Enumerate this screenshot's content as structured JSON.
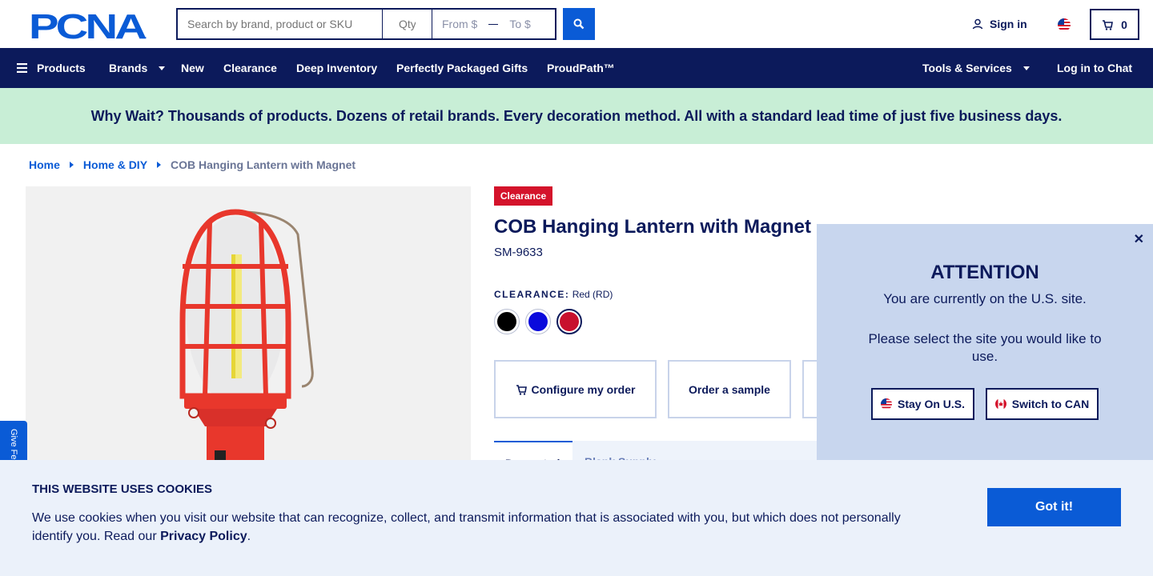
{
  "header": {
    "logo_text": "PCNA",
    "search_placeholder": "Search by brand, product or SKU",
    "qty_placeholder": "Qty",
    "price_from": "From $",
    "price_to": "To $",
    "signin_label": "Sign in",
    "cart_count": "0"
  },
  "nav": {
    "products": "Products",
    "brands": "Brands",
    "new": "New",
    "clearance": "Clearance",
    "deep_inventory": "Deep Inventory",
    "gifts": "Perfectly Packaged Gifts",
    "proudpath": "ProudPath™",
    "tools": "Tools & Services",
    "chat": "Log in to Chat"
  },
  "promo": {
    "text": "Why Wait? Thousands of products. Dozens of retail brands. Every decoration method. All with a standard lead time of just five business days."
  },
  "breadcrumb": {
    "home": "Home",
    "category": "Home & DIY",
    "current": "COB Hanging Lantern with Magnet"
  },
  "feedback": {
    "label": "Give Fe"
  },
  "product": {
    "badge": "Clearance",
    "title": "COB Hanging Lantern with Magnet",
    "sku": "SM-9633",
    "color_heading": "CLEARANCE:",
    "color_value": "Red (RD)",
    "swatches": [
      {
        "name": "Black",
        "color": "#000000"
      },
      {
        "name": "Blue",
        "color": "#0a0adc"
      },
      {
        "name": "Red",
        "color": "#c8102e"
      }
    ],
    "actions": {
      "configure": "Configure my order",
      "sample": "Order a sample"
    },
    "tabs": {
      "active": "Decorated",
      "other": "Blank Supply"
    }
  },
  "attention": {
    "title": "ATTENTION",
    "message1": "You are currently on the U.S. site.",
    "message2": "Please select the site you would like to use.",
    "stay": "Stay On U.S.",
    "switch": "Switch to CAN"
  },
  "cookie": {
    "title": "THIS WEBSITE USES COOKIES",
    "text_before": "We use cookies when you visit our website that can recognize, collect, and transmit information that is associated with you, but which does not personally identify you. Read our ",
    "link": "Privacy Policy",
    "text_after": ".",
    "button": "Got it!"
  },
  "colors": {
    "navy": "#0c1a5b",
    "blue": "#0a5bd6",
    "promo_bg": "#c8eed6",
    "clearance_red": "#d4132b",
    "product_red": "#e8372c"
  }
}
